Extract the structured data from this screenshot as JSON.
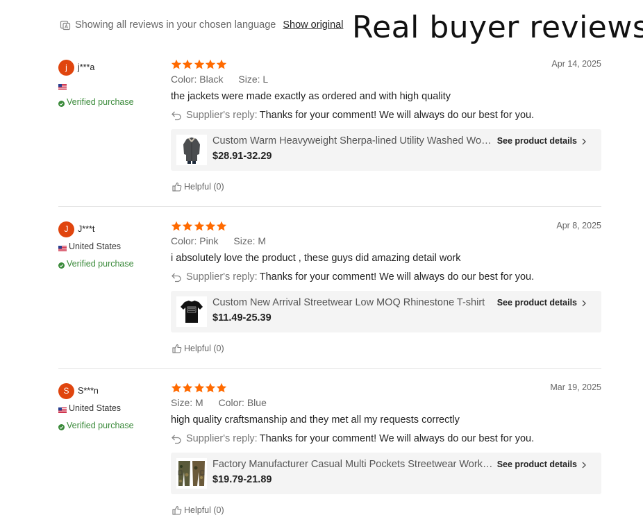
{
  "topbar": {
    "language_note": "Showing all reviews in your chosen language",
    "show_original_label": "Show original"
  },
  "overlay_title": "Real buyer reviews",
  "reviews": [
    {
      "avatar_letter": "j",
      "username": "j***a",
      "country": "",
      "verified_label": "Verified purchase",
      "rating": 5,
      "date": "Apr 14, 2025",
      "attributes": [
        {
          "key": "Color:",
          "value": "Black"
        },
        {
          "key": "Size:",
          "value": "L"
        }
      ],
      "comment": "the jackets were made exactly as ordered and with high quality",
      "reply_label": "Supplier's reply:",
      "reply_text": "Thanks for your comment! We will always do our best for you.",
      "product_name": "Custom Warm Heavyweight Sherpa-lined Utility Washed Work Jacket",
      "product_price": "$28.91-32.29",
      "see_details_label": "See product details",
      "helpful_label": "Helpful (0)"
    },
    {
      "avatar_letter": "J",
      "username": "J***t",
      "country": "United States",
      "verified_label": "Verified purchase",
      "rating": 5,
      "date": "Apr 8, 2025",
      "attributes": [
        {
          "key": "Color:",
          "value": "Pink"
        },
        {
          "key": "Size:",
          "value": "M"
        }
      ],
      "comment": "i absolutely love the product , these guys did amazing detail work",
      "reply_label": "Supplier's reply:",
      "reply_text": "Thanks for your comment! We will always do our best for you.",
      "product_name": "Custom New Arrival Streetwear Low MOQ Rhinestone T-shirt",
      "product_price": "$11.49-25.39",
      "see_details_label": "See product details",
      "helpful_label": "Helpful (0)"
    },
    {
      "avatar_letter": "S",
      "username": "S***n",
      "country": "United States",
      "verified_label": "Verified purchase",
      "rating": 5,
      "date": "Mar 19, 2025",
      "attributes": [
        {
          "key": "Size:",
          "value": "M"
        },
        {
          "key": "Color:",
          "value": "Blue"
        }
      ],
      "comment": "high quality craftsmanship and they met all my requests correctly",
      "reply_label": "Supplier's reply:",
      "reply_text": "Thanks for your comment! We will always do our best for you.",
      "product_name": "Factory Manufacturer Casual Multi Pockets Streetwear Work Pants",
      "product_price": "$19.79-21.89",
      "see_details_label": "See product details",
      "helpful_label": "Helpful (0)"
    }
  ],
  "colors": {
    "star": "#ff6a00",
    "avatar": "#e0450e",
    "verified": "#3a8a3a"
  },
  "icons": {
    "language": "translate-icon",
    "reply": "reply-arrow-icon",
    "helpful": "thumbs-up-icon",
    "details": "chevron-right-icon"
  }
}
